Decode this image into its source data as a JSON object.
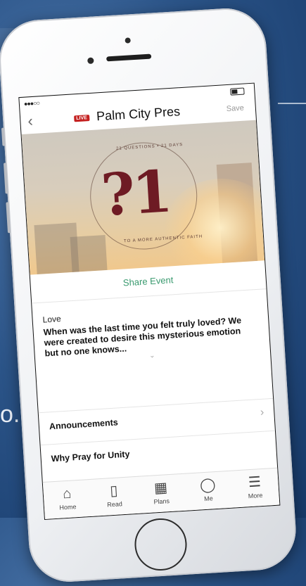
{
  "background": {
    "partial_text": "o."
  },
  "status_bar": {
    "signal": "●●●○○"
  },
  "nav": {
    "back_icon": "chevron-left-icon",
    "live_badge": "LIVE",
    "title": "Palm City Pres",
    "save_label": "Save"
  },
  "hero": {
    "logo_text": "?1",
    "ring_text_top": "21 QUESTIONS • 21 DAYS",
    "ring_text_bottom": "TO A MORE AUTHENTIC FAITH"
  },
  "share_label": "Share Event",
  "love_section": {
    "heading": "Love",
    "description": "When was the last time you felt truly loved? We were created to desire this mysterious emotion but no one knows...",
    "expand_icon": "chevron-down-icon"
  },
  "rows": [
    {
      "label": "Announcements"
    },
    {
      "label": "Why Pray for Unity"
    }
  ],
  "tabs": [
    {
      "label": "Home",
      "icon": "home-icon"
    },
    {
      "label": "Read",
      "icon": "book-icon"
    },
    {
      "label": "Plans",
      "icon": "calendar-icon"
    },
    {
      "label": "Me",
      "icon": "user-icon"
    },
    {
      "label": "More",
      "icon": "menu-icon"
    }
  ],
  "colors": {
    "accent_green": "#3a9a6f",
    "live_red": "#c4201f",
    "logo_maroon": "#6e1b24"
  }
}
